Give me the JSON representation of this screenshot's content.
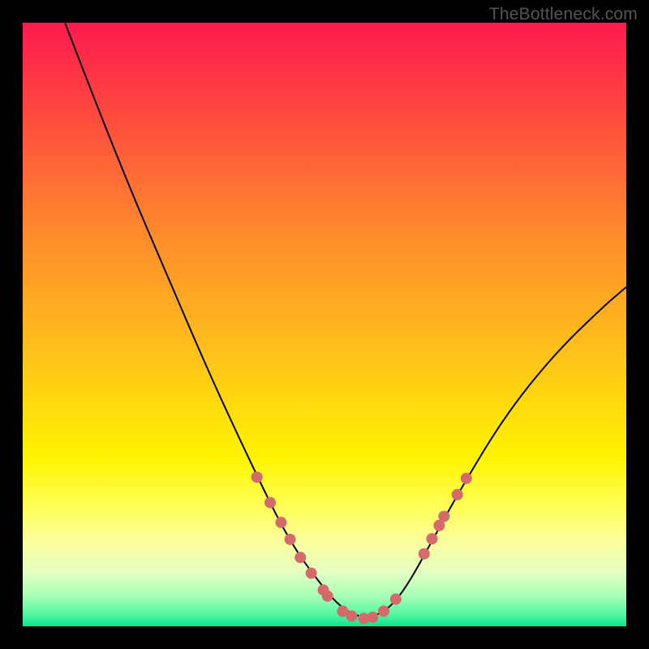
{
  "watermark": "TheBottleneck.com",
  "chart_data": {
    "type": "line",
    "title": "",
    "xlabel": "",
    "ylabel": "",
    "xlim": [
      0,
      1
    ],
    "ylim": [
      0,
      1
    ],
    "grid": false,
    "legend": false,
    "background_gradient": {
      "stops": [
        {
          "offset": 0.0,
          "color": "#ff1a50"
        },
        {
          "offset": 0.15,
          "color": "#ff493f"
        },
        {
          "offset": 0.35,
          "color": "#ff8b2c"
        },
        {
          "offset": 0.55,
          "color": "#ffc21a"
        },
        {
          "offset": 0.72,
          "color": "#fff400"
        },
        {
          "offset": 0.8,
          "color": "#ffff55"
        },
        {
          "offset": 0.86,
          "color": "#fcff9e"
        },
        {
          "offset": 0.91,
          "color": "#e4ffc0"
        },
        {
          "offset": 0.95,
          "color": "#a6ffb7"
        },
        {
          "offset": 0.98,
          "color": "#55f7a1"
        },
        {
          "offset": 1.0,
          "color": "#07e68e"
        }
      ]
    },
    "series": [
      {
        "name": "curve",
        "x": [
          0.07,
          0.12,
          0.18,
          0.24,
          0.3,
          0.35,
          0.4,
          0.43,
          0.46,
          0.49,
          0.52,
          0.55,
          0.58,
          0.61,
          0.64,
          0.68,
          0.73,
          0.8,
          0.88,
          0.96,
          1.0
        ],
        "y": [
          1.0,
          0.87,
          0.72,
          0.58,
          0.44,
          0.33,
          0.225,
          0.165,
          0.115,
          0.075,
          0.038,
          0.017,
          0.015,
          0.032,
          0.072,
          0.145,
          0.235,
          0.35,
          0.45,
          0.528,
          0.562
        ]
      }
    ],
    "markers": {
      "name": "highlight-dots",
      "color": "#d46a6a",
      "radius": 7,
      "points": [
        {
          "x": 0.388,
          "y": 0.247
        },
        {
          "x": 0.41,
          "y": 0.205
        },
        {
          "x": 0.428,
          "y": 0.172
        },
        {
          "x": 0.443,
          "y": 0.144
        },
        {
          "x": 0.46,
          "y": 0.114
        },
        {
          "x": 0.478,
          "y": 0.088
        },
        {
          "x": 0.498,
          "y": 0.06
        },
        {
          "x": 0.505,
          "y": 0.05
        },
        {
          "x": 0.53,
          "y": 0.025
        },
        {
          "x": 0.545,
          "y": 0.017
        },
        {
          "x": 0.565,
          "y": 0.013
        },
        {
          "x": 0.58,
          "y": 0.015
        },
        {
          "x": 0.598,
          "y": 0.025
        },
        {
          "x": 0.618,
          "y": 0.045
        },
        {
          "x": 0.665,
          "y": 0.12
        },
        {
          "x": 0.678,
          "y": 0.145
        },
        {
          "x": 0.69,
          "y": 0.167
        },
        {
          "x": 0.698,
          "y": 0.182
        },
        {
          "x": 0.72,
          "y": 0.218
        },
        {
          "x": 0.735,
          "y": 0.245
        }
      ]
    }
  }
}
